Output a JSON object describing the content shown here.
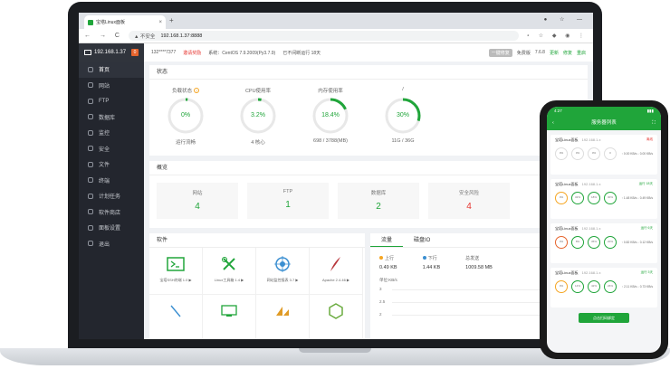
{
  "browser": {
    "tab_title": "宝塔Linux面板",
    "tab_close": "×",
    "new_tab": "+",
    "window_controls": "● ☆ —",
    "nav_controls": "← → C",
    "not_secure": "▲ 不安全",
    "url": "192.168.1.37:8888",
    "toolbar": "⋆ ☆ ◆ ◉ ⋮"
  },
  "sidebar": {
    "host": "192.168.1.37",
    "badge": "0",
    "items": [
      {
        "label": "首页"
      },
      {
        "label": "网站"
      },
      {
        "label": "FTP"
      },
      {
        "label": "数据库"
      },
      {
        "label": "监控"
      },
      {
        "label": "安全"
      },
      {
        "label": "文件"
      },
      {
        "label": "终端"
      },
      {
        "label": "计划任务"
      },
      {
        "label": "软件商店"
      },
      {
        "label": "面板设置"
      },
      {
        "label": "退出"
      }
    ]
  },
  "topinfo": {
    "user": "132****7377",
    "certified": "邀请奖励",
    "system": "系统：CentOS 7.9.2009(Py3.7.9)",
    "uptime": "已不间断运行 18天",
    "pill": "一键修复",
    "free": "免费版",
    "version": "7.6.8",
    "update": "更新",
    "repair": "修复",
    "restart": "重启"
  },
  "status": {
    "title": "状态",
    "help_mark": "?",
    "gauges": [
      {
        "label": "负载状态",
        "value": "0%",
        "sub": "运行流畅",
        "pct": 0.02
      },
      {
        "label": "CPU使用率",
        "value": "3.2%",
        "sub": "4 核心",
        "pct": 0.032
      },
      {
        "label": "内存使用率",
        "value": "18.4%",
        "sub": "698 / 3788(MB)",
        "pct": 0.184
      },
      {
        "label": "/",
        "value": "30%",
        "sub": "11G / 36G",
        "pct": 0.3
      }
    ]
  },
  "overview": {
    "title": "概览",
    "items": [
      {
        "label": "网站",
        "value": "4"
      },
      {
        "label": "FTP",
        "value": "1"
      },
      {
        "label": "数据库",
        "value": "2"
      },
      {
        "label": "安全风险",
        "value": "4"
      }
    ]
  },
  "software": {
    "title": "软件",
    "items": [
      {
        "label": "宝塔SSH终端 1.0 ▶"
      },
      {
        "label": "Linux工具箱 1.4 ▶"
      },
      {
        "label": "网站监控报表 3.7 ▶"
      },
      {
        "label": "Apache 2.4.46 ▶"
      },
      {
        "label": ""
      },
      {
        "label": ""
      },
      {
        "label": ""
      },
      {
        "label": ""
      }
    ]
  },
  "traffic": {
    "tab_traffic": "流量",
    "tab_io": "磁盘IO",
    "up_label": "上行",
    "up_value": "0.49 KB",
    "down_label": "下行",
    "down_value": "1.44 KB",
    "sent_label": "总发送",
    "sent_value": "1009.58 MB",
    "unit": "单位:KB/s",
    "ticks": [
      "3",
      "2.5",
      "2"
    ]
  },
  "phone": {
    "time": "4:27",
    "signal": "▮▮▮",
    "back": "‹",
    "expand": "⛶",
    "title": "服务器列表",
    "servers": [
      {
        "name": "宝塔Linux面板",
        "ip": "192.168.1.x",
        "state": "离线",
        "r1": "0%",
        "r2": "0%",
        "r3": "0%",
        "r4": "0",
        "stats": "↑ 0.00 KB/s ↓ 0.00 KB/s"
      },
      {
        "name": "宝塔Linux面板",
        "ip": "192.168.1.x",
        "state": "运行 18天",
        "r1": "0%",
        "r2": "32%",
        "r3": "18%",
        "r4": "30%",
        "stats": "↑ 1.48 KB/s ↓ 0.49 KB/s"
      },
      {
        "name": "宝塔Linux面板",
        "ip": "192.168.1.x",
        "state": "运行 6天",
        "r1": "0%",
        "r2": "8%",
        "r3": "35%",
        "r4": "20%",
        "stats": "↑ 0.82 KB/s ↓ 0.12 KB/s"
      },
      {
        "name": "宝塔Linux面板",
        "ip": "192.168.1.x",
        "state": "运行 3天",
        "r1": "0%",
        "r2": "14%",
        "r3": "42%",
        "r4": "26%",
        "stats": "↑ 2.11 KB/s ↓ 0.73 KB/s"
      }
    ],
    "button": "点击扫码绑定"
  },
  "colors": {
    "accent": "#20a53a",
    "danger": "#e6342f",
    "sidebar": "#23262e"
  }
}
